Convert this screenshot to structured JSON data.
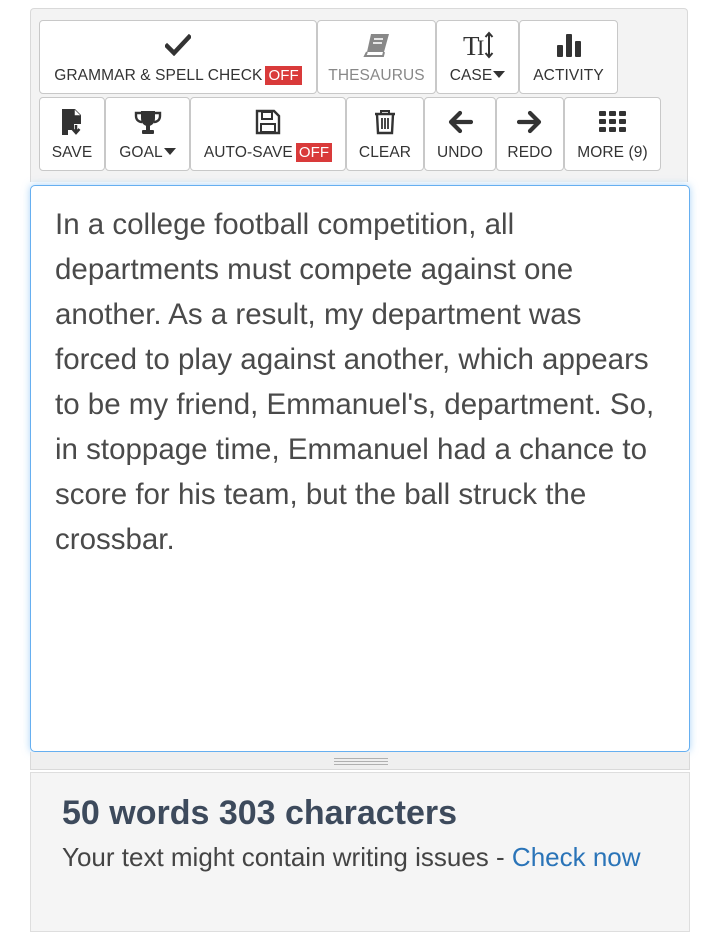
{
  "toolbar": {
    "row1": {
      "grammar": {
        "label": "GRAMMAR & SPELL CHECK",
        "state": "OFF",
        "icon": "check-icon"
      },
      "thesaurus": {
        "label": "THESAURUS",
        "icon": "book-icon"
      },
      "case": {
        "label": "CASE",
        "icon": "text-case-icon"
      },
      "activity": {
        "label": "ACTIVITY",
        "icon": "bar-chart-icon"
      }
    },
    "row2": {
      "save": {
        "label": "SAVE",
        "icon": "save-download-icon"
      },
      "goal": {
        "label": "GOAL",
        "icon": "trophy-icon"
      },
      "autosave": {
        "label": "AUTO-SAVE",
        "state": "OFF",
        "icon": "floppy-disk-icon"
      },
      "clear": {
        "label": "CLEAR",
        "icon": "trash-icon"
      },
      "undo": {
        "label": "UNDO",
        "icon": "arrow-left-icon"
      },
      "redo": {
        "label": "REDO",
        "icon": "arrow-right-icon"
      },
      "more": {
        "label": "MORE (9)",
        "icon": "grid-icon"
      }
    }
  },
  "editor": {
    "text": "In a college football competition, all departments must compete against one another. As a result, my department was forced to play against another, which appears to be my friend, Emmanuel's, department. So, in stoppage time, Emmanuel had a chance to score for his team, but the ball struck the crossbar."
  },
  "stats": {
    "counts": "50 words 303 characters",
    "message": "Your text might contain writing issues - ",
    "link": "Check now"
  },
  "colors": {
    "badge": "#d93a3a",
    "focus_border": "#66aff0",
    "link": "#2a74b8",
    "counts": "#3d4a5c"
  }
}
